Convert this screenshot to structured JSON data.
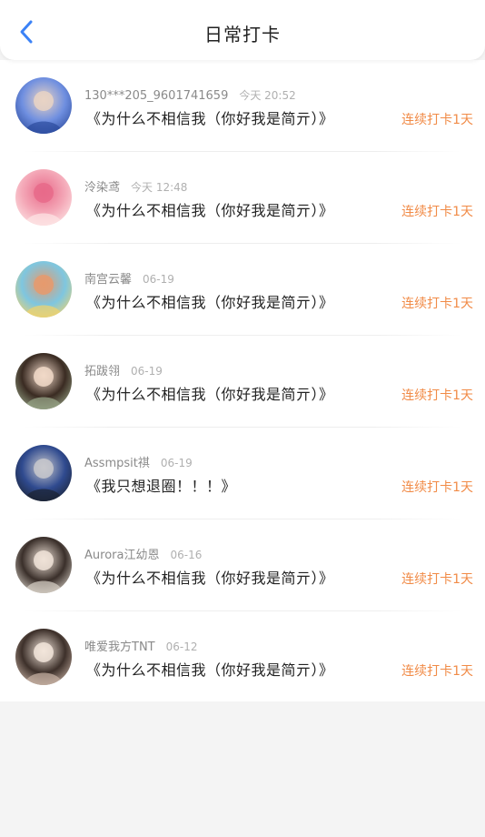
{
  "header": {
    "title": "日常打卡",
    "back_icon": "chevron-left-icon",
    "accent": "#3b82f6"
  },
  "streak_color": "#f18b47",
  "items": [
    {
      "username": "130***205_9601741659",
      "time": "今天 20:52",
      "content": "《为什么不相信我（你好我是简亓）》",
      "streak": "连续打卡1天",
      "avatar_colors": [
        "#2b4a9c",
        "#6f8fe0",
        "#e9d3c4"
      ]
    },
    {
      "username": "泠染鸢",
      "time": "今天 12:48",
      "content": "《为什么不相信我（你好我是简亓）》",
      "streak": "连续打卡1天",
      "avatar_colors": [
        "#fde6e6",
        "#f4a9b8",
        "#e86a8a"
      ]
    },
    {
      "username": "南宫云馨",
      "time": "06-19",
      "content": "《为什么不相信我（你好我是简亓）》",
      "streak": "连续打卡1天",
      "avatar_colors": [
        "#f2d36b",
        "#7ec6e0",
        "#e69a6d"
      ]
    },
    {
      "username": "拓跋翎",
      "time": "06-19",
      "content": "《为什么不相信我（你好我是简亓）》",
      "streak": "连续打卡1天",
      "avatar_colors": [
        "#9aa88a",
        "#3a2b22",
        "#f1d9c8"
      ]
    },
    {
      "username": "Assmpsit祺",
      "time": "06-19",
      "content": "《我只想退圈！！！》",
      "streak": "连续打卡1天",
      "avatar_colors": [
        "#1b2230",
        "#2f4a8f",
        "#c8c8cc"
      ]
    },
    {
      "username": "Aurora江幼恩",
      "time": "06-16",
      "content": "《为什么不相信我（你好我是简亓）》",
      "streak": "连续打卡1天",
      "avatar_colors": [
        "#d9d2c8",
        "#3a2f2a",
        "#f0e3d8"
      ]
    },
    {
      "username": "唯爱我方TNT",
      "time": "06-12",
      "content": "《为什么不相信我（你好我是简亓）》",
      "streak": "连续打卡1天",
      "avatar_colors": [
        "#c9b3a5",
        "#3d302a",
        "#f2e5da"
      ]
    }
  ]
}
